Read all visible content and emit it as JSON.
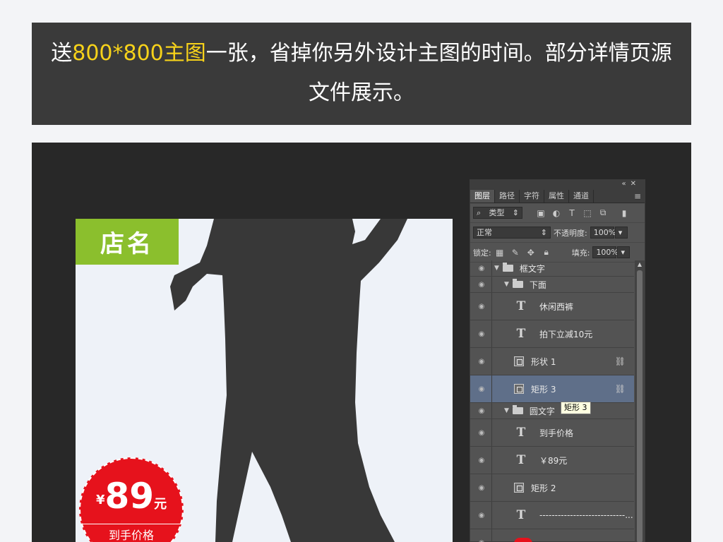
{
  "banner": {
    "line1_pre": "送",
    "line1_highlight": "800*800主图",
    "line1_post": "一张，省掉你另外设计主图的时间。部分详情页源",
    "line2": "文件展示。"
  },
  "canvas": {
    "shop_name": "店名",
    "price": {
      "currency": "¥",
      "amount": "89",
      "unit": "元",
      "label": "到手价格"
    }
  },
  "layers_panel": {
    "tabs": [
      "图层",
      "路径",
      "字符",
      "属性",
      "通道"
    ],
    "active_tab": "图层",
    "filter_label": "类型",
    "blend_mode": "正常",
    "opacity_label": "不透明度:",
    "opacity_value": "100%",
    "lock_label": "锁定:",
    "fill_label": "填充:",
    "fill_value": "100%",
    "tooltip": "矩形 3",
    "layers": [
      {
        "kind": "group",
        "depth": 0,
        "name": "框文字"
      },
      {
        "kind": "group",
        "depth": 1,
        "name": "下面"
      },
      {
        "kind": "text",
        "depth": 2,
        "name": "休闲西裤"
      },
      {
        "kind": "text",
        "depth": 2,
        "name": "拍下立减10元"
      },
      {
        "kind": "shape",
        "depth": 2,
        "name": "形状 1",
        "linked": true
      },
      {
        "kind": "shape",
        "depth": 2,
        "name": "矩形 3",
        "linked": true,
        "selected": true
      },
      {
        "kind": "group",
        "depth": 1,
        "name": "圆文字"
      },
      {
        "kind": "text",
        "depth": 2,
        "name": "到手价格"
      },
      {
        "kind": "text",
        "depth": 2,
        "name": "￥89元"
      },
      {
        "kind": "shape",
        "depth": 2,
        "name": "矩形 2"
      },
      {
        "kind": "text",
        "depth": 2,
        "name": "----------------------------..."
      },
      {
        "kind": "ellipse",
        "depth": 2,
        "name": ""
      }
    ]
  },
  "colors": {
    "banner_bg": "#3a3a3a",
    "highlight": "#f7d21a",
    "shop_tag": "#8bbf2d",
    "price_red": "#e6121c",
    "panel_bg": "#535353",
    "selected_layer": "#5f6f89"
  }
}
